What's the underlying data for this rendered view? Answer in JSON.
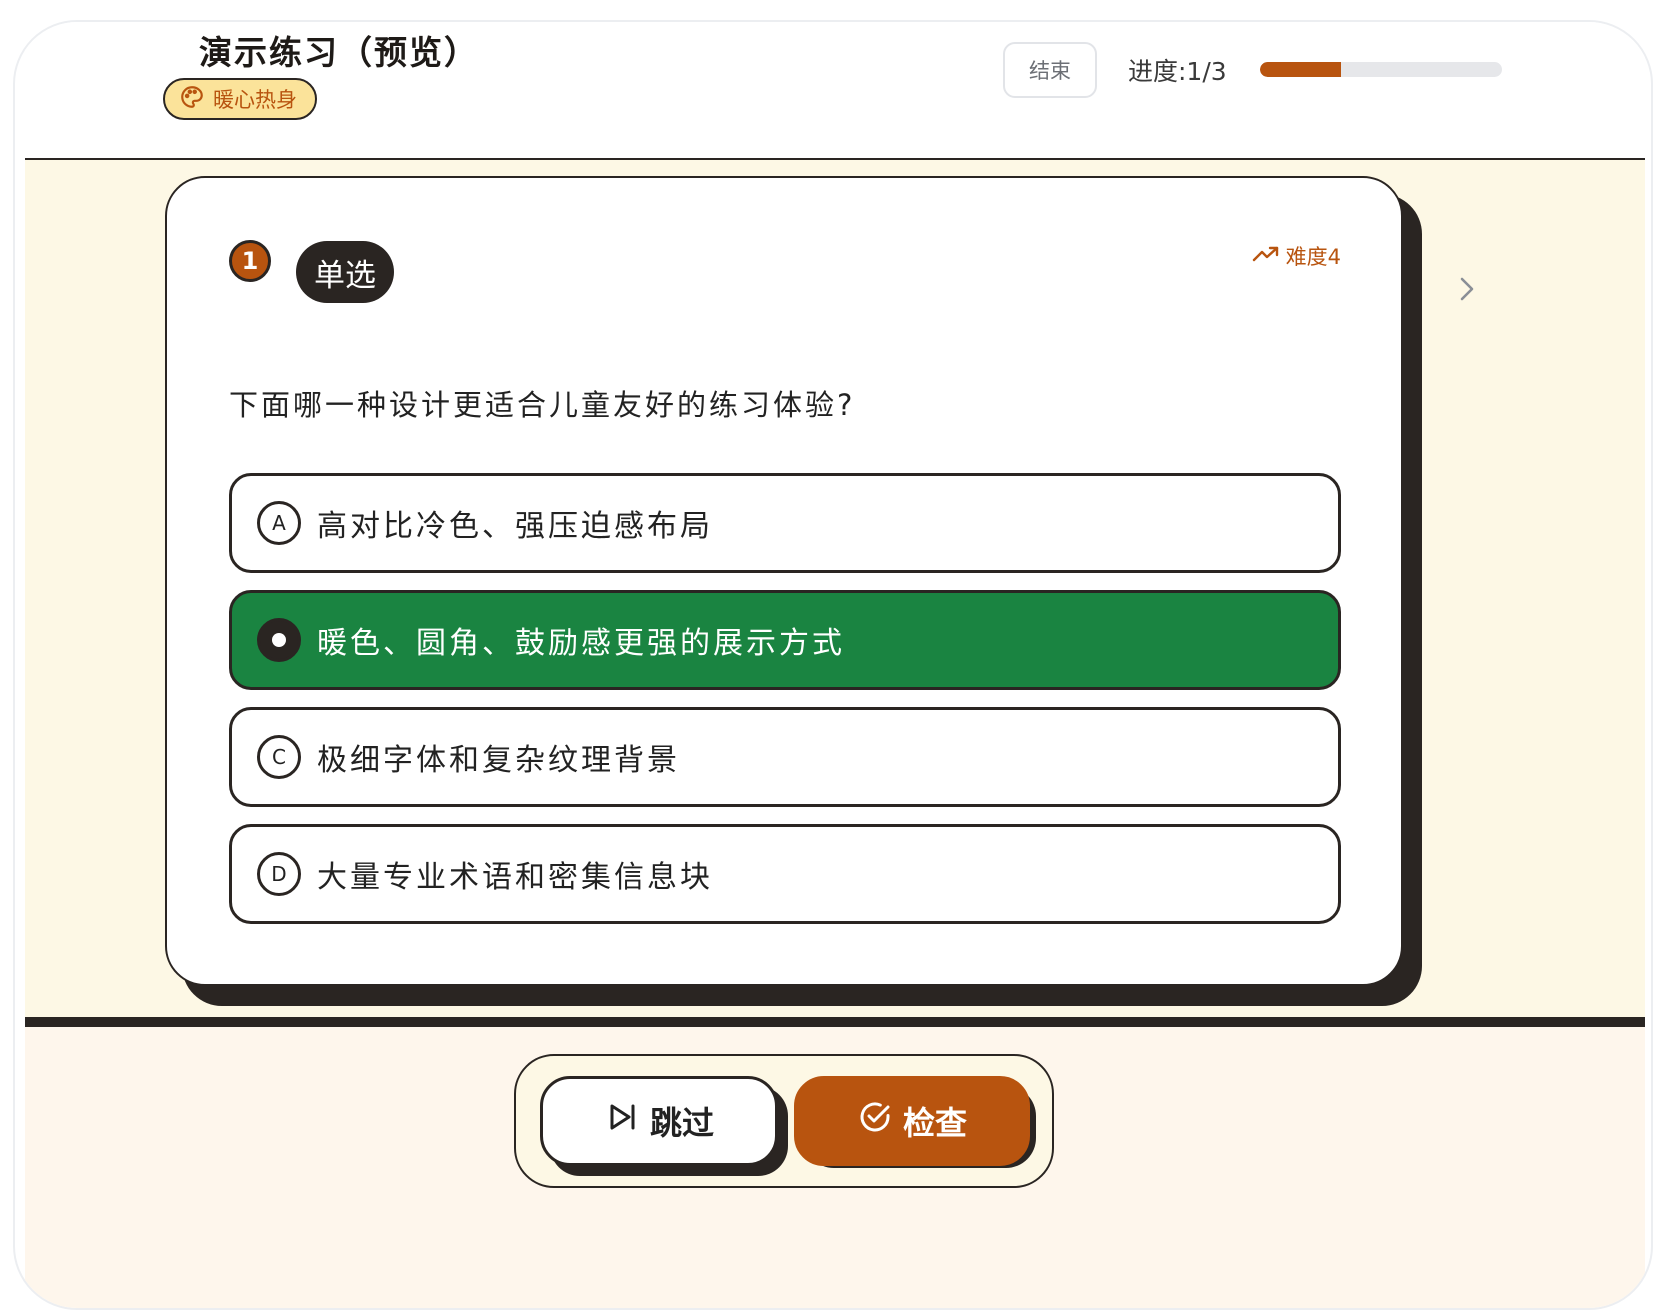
{
  "header": {
    "title": "演示练习（预览）",
    "tag_label": "暖心热身",
    "end_label": "结束",
    "progress_label": "进度:1/3",
    "progress_fraction": 0.333
  },
  "question": {
    "number": "1",
    "type_label": "单选",
    "difficulty_label": "难度4",
    "text": "下面哪一种设计更适合儿童友好的练习体验?",
    "options": [
      {
        "letter": "A",
        "text": "高对比冷色、强压迫感布局",
        "selected": false
      },
      {
        "letter": "B",
        "text": "暖色、圆角、鼓励感更强的展示方式",
        "selected": true
      },
      {
        "letter": "C",
        "text": "极细字体和复杂纹理背景",
        "selected": false
      },
      {
        "letter": "D",
        "text": "大量专业术语和密集信息块",
        "selected": false
      }
    ]
  },
  "actions": {
    "skip_label": "跳过",
    "check_label": "检查"
  },
  "colors": {
    "accent": "#b8540f",
    "selected": "#1a8441",
    "tag_bg": "#fbe39a",
    "main_bg": "#fdf8e5",
    "dark": "#2a2522"
  },
  "icons": {
    "tag": "palette-icon",
    "difficulty": "trending-up-icon",
    "next": "chevron-right-icon",
    "skip": "skip-forward-icon",
    "check": "check-circle-icon"
  }
}
